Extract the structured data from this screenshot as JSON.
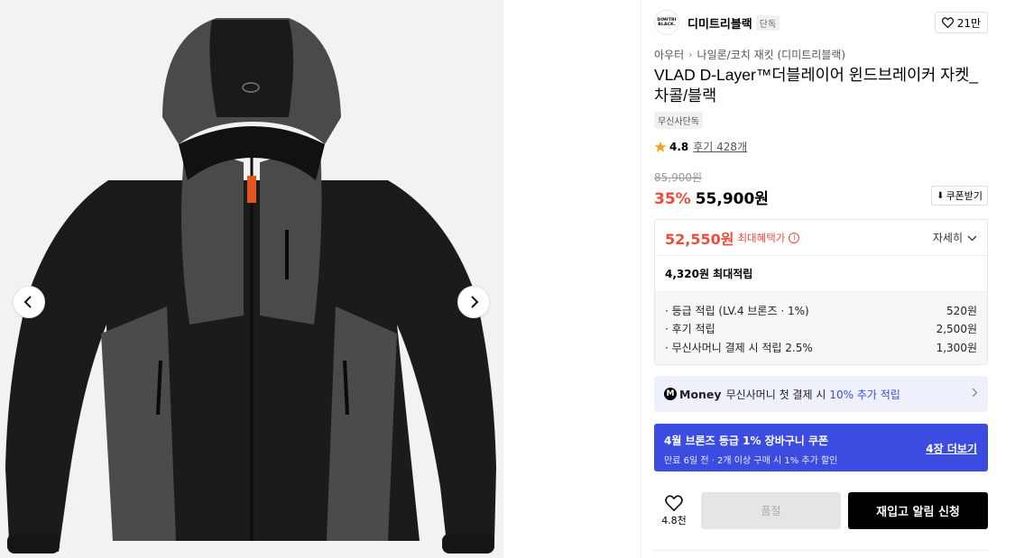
{
  "gallery": {
    "prev_icon": "chevron-left-icon",
    "next_icon": "chevron-right-icon"
  },
  "brand": {
    "logo_text": "DIMITRI BLACK.",
    "name": "디미트리블랙",
    "badge": "단독",
    "like_count": "21만"
  },
  "breadcrumb": {
    "category": "아우터",
    "subcategory": "나일론/코치 재킷 (디미트리블랙)"
  },
  "product": {
    "title": "VLAD D-Layer™더블레이어 윈드브레이커 자켓_차콜/블랙",
    "exclusive_badge": "무신사단독",
    "rating": "4.8",
    "reviews": "후기 428개",
    "original_price": "85,900원",
    "discount": "35%",
    "price": "55,900원",
    "coupon_button": "쿠폰받기"
  },
  "benefits": {
    "max_price": "52,550원",
    "max_label": "최대혜택가",
    "detail_label": "자세히",
    "points_summary": "4,320원 최대적립",
    "items": [
      {
        "label": "· 등급 적립 (LV.4 브론즈 · 1%)",
        "value": "520원"
      },
      {
        "label": "· 후기 적립",
        "value": "2,500원"
      },
      {
        "label": "· 무신사머니 결제 시 적립 2.5%",
        "value": "1,300원"
      }
    ]
  },
  "money_banner": {
    "logo": "Money",
    "text": "무신사머니 첫 결제 시",
    "highlight": "10% 추가 적립"
  },
  "coupon_banner": {
    "title": "4월 브론즈 등급 1% 장바구니 쿠폰",
    "subtitle": "만료 6일 전 · 2개 이상 구매 시 1% 추가 할인",
    "more": "4장 더보기"
  },
  "actions": {
    "wish_count": "4.8천",
    "soldout_label": "품절",
    "restock_label": "재입고 알림 신청"
  },
  "colors": {
    "accent_red": "#f04a3a",
    "coupon_blue": "#3c4ce0",
    "money_bg": "#eef1fb"
  }
}
